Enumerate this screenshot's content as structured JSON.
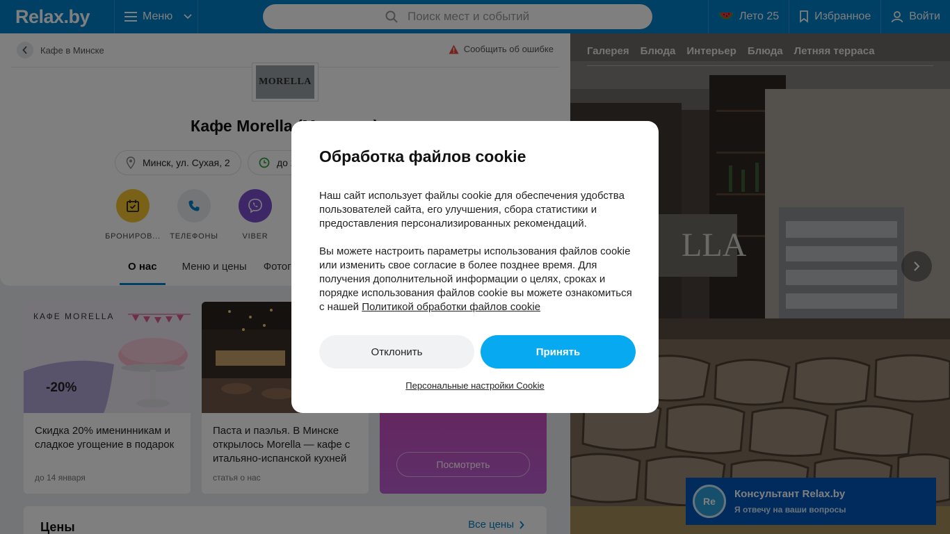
{
  "header": {
    "logo": "Relax.by",
    "menu_label": "Меню",
    "search_placeholder": "Поиск мест и событий",
    "summer_label": "Лето 25",
    "favorites_label": "Избранное",
    "login_label": "Войти"
  },
  "place": {
    "breadcrumb": "Кафе в Минске",
    "report_label": "Сообщить об ошибке",
    "logo_text": "MORELLA",
    "title": "Кафе Morella (Морелла)",
    "address": "Минск, ул. Сухая, 2",
    "hours": "до 23:00",
    "actions": [
      {
        "label": "БРОНИРОВ..."
      },
      {
        "label": "ТЕЛЕФОНЫ"
      },
      {
        "label": "VIBER"
      }
    ],
    "tabs": [
      "О нас",
      "Меню и цены",
      "Фотографии"
    ]
  },
  "promos": [
    {
      "cafe_label": "КАФЕ MORELLA",
      "badge": "-20%",
      "text": "Скидка 20% именинникам и сладкое угощение в подарок",
      "meta": "до 14 января"
    },
    {
      "text": "Паста и паэлья. В Минске открылось Morella — кафе с итальяно-испанской кухней",
      "meta": "статья о нас"
    },
    {
      "button": "Посмотреть"
    }
  ],
  "prices": {
    "title": "Цены",
    "link": "Все цены"
  },
  "gallery": {
    "tabs": [
      "Галерея",
      "Блюда",
      "Интерьер",
      "Блюда",
      "Летняя терраса"
    ]
  },
  "consultant": {
    "avatar": "Re",
    "title": "Консультант Relax.by",
    "subtitle": "Я отвечу на ваши вопросы"
  },
  "cookie": {
    "title": "Обработка файлов cookie",
    "para1": "Наш сайт использует файлы cookie для обеспечения удобства пользователей сайта, его улучшения, сбора статистики и предоставления персонализированных рекомендаций.",
    "para2": "Вы можете настроить параметры использования файлов cookie или изменить свое согласие в более позднее время. Для получения дополнительной информации о целях, сроках и порядке использования файлов cookie вы можете ознакомиться с нашей",
    "policy_link": "Политикой обработки файлов cookie",
    "decline": "Отклонить",
    "accept": "Принять",
    "settings_link": "Персональные настройки Cookie"
  },
  "colors": {
    "brand": "#0081c9",
    "accent": "#07aaf0",
    "viber": "#7d4fcf",
    "booking": "#f2c530"
  }
}
